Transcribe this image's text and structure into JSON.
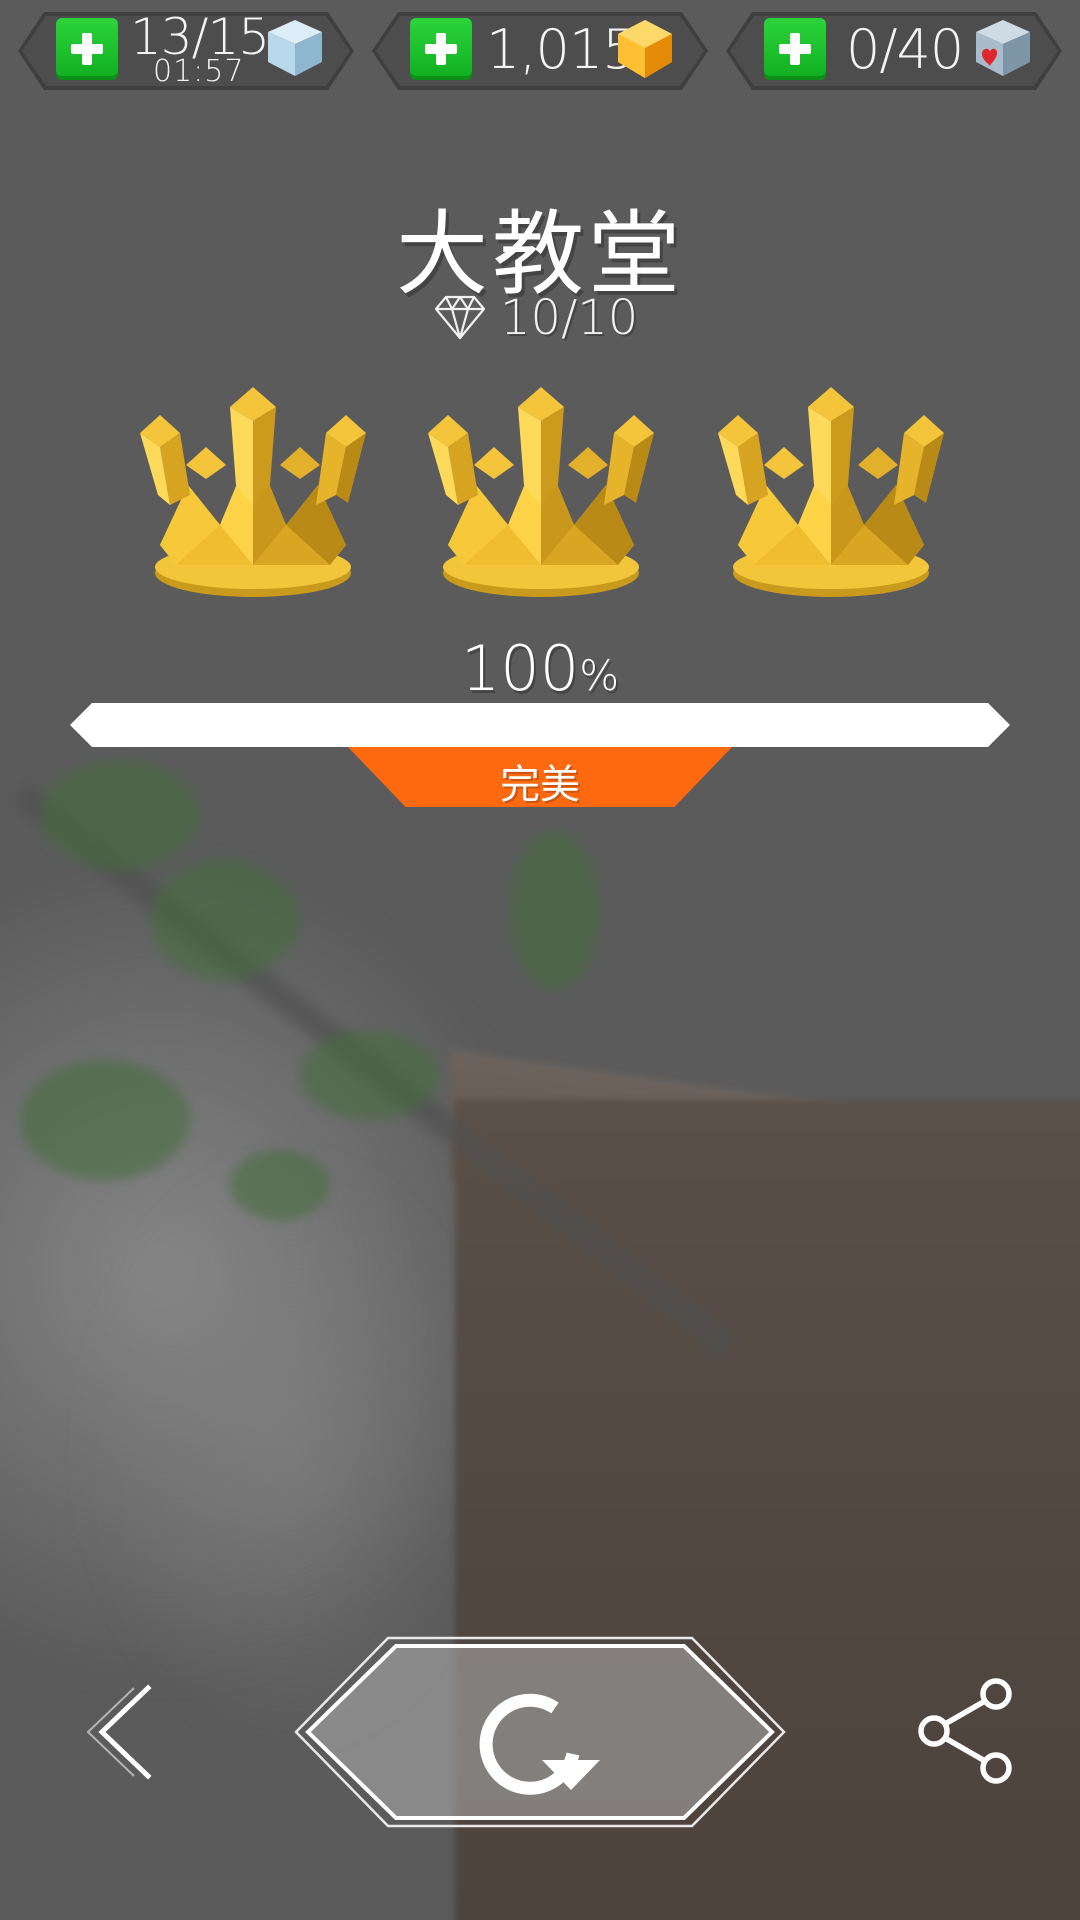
{
  "resources": {
    "energy": {
      "count": "13/15",
      "timer": "01:57",
      "icon": "ice-cube-icon"
    },
    "coins": {
      "count": "1,015",
      "icon": "gold-gem-icon"
    },
    "hearts": {
      "count": "0/40",
      "icon": "heart-cube-icon"
    }
  },
  "level": {
    "title": "大教堂",
    "gems": "10/10",
    "crowns_earned": 3,
    "crowns_total": 3,
    "progress": 1.0,
    "percent_number": "100",
    "percent_sign": "%",
    "rating": "完美"
  },
  "controls": {
    "back_icon": "chevron-left-icon",
    "replay_icon": "replay-icon",
    "share_icon": "share-icon"
  },
  "colors": {
    "accent": "#ff6a10",
    "plus_green": "#1ec02e",
    "gold": "#e8b92a",
    "background": "#5b5b5c"
  }
}
